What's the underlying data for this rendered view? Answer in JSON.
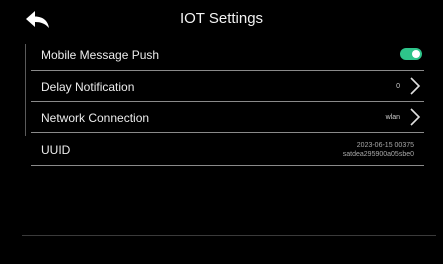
{
  "header": {
    "title": "IOT Settings",
    "back_icon": "back-arrow-icon"
  },
  "settings": {
    "mobile_push": {
      "label": "Mobile Message Push",
      "enabled": true,
      "toggle_color": "#2ec48a"
    },
    "delay_notification": {
      "label": "Delay Notification",
      "value": "0"
    },
    "network_connection": {
      "label": "Network Connection",
      "value": "wlan"
    },
    "uuid": {
      "label": "UUID",
      "value_line1": "2023-06-15 00375",
      "value_line2": "satdea295900a05sbe0"
    }
  }
}
